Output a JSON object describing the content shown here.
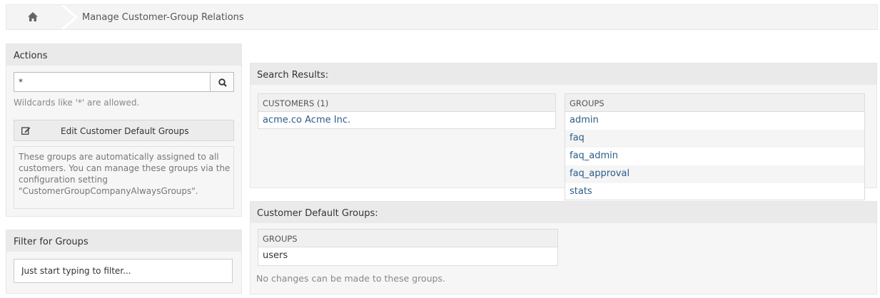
{
  "breadcrumb": {
    "home_icon": "home-icon",
    "title": "Manage Customer-Group Relations"
  },
  "sidebar": {
    "actions": {
      "title": "Actions",
      "search_value": "*",
      "search_icon": "search-icon",
      "hint": "Wildcards like '*' are allowed.",
      "edit_button": "Edit Customer Default Groups",
      "edit_icon": "edit-icon",
      "info": "These groups are automatically assigned to all customers. You can manage these groups via the configuration setting \"CustomerGroupCompanyAlwaysGroups\"."
    },
    "filter": {
      "title": "Filter for Groups",
      "placeholder": "Just start typing to filter..."
    }
  },
  "results": {
    "title": "Search Results:",
    "customers": {
      "header": "CUSTOMERS (1)",
      "rows": [
        "acme.co Acme Inc."
      ]
    },
    "groups": {
      "header": "GROUPS",
      "rows": [
        "admin",
        "faq",
        "faq_admin",
        "faq_approval",
        "stats"
      ]
    }
  },
  "defaults": {
    "title": "Customer Default Groups:",
    "groups": {
      "header": "GROUPS",
      "rows": [
        "users"
      ]
    },
    "note": "No changes can be made to these groups."
  }
}
